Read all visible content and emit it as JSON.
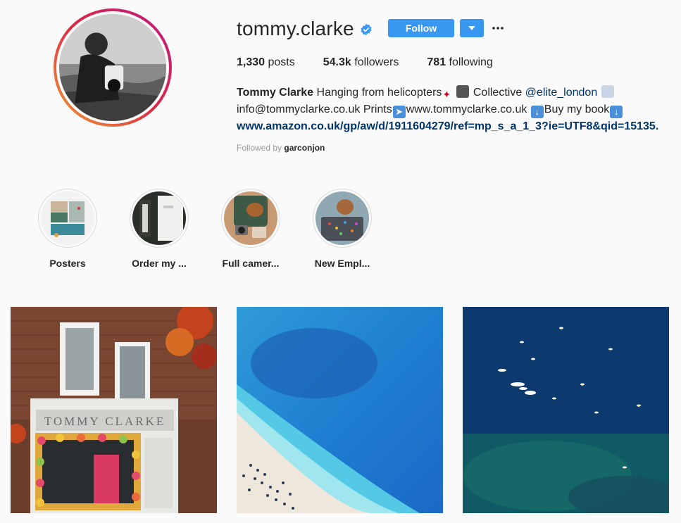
{
  "profile": {
    "username": "tommy.clarke",
    "verified": true,
    "full_name": "Tommy Clarke",
    "bio_line1_text": "Hanging from helicopters",
    "bio_line1_after": "Collective",
    "bio_mention": "@elite_london",
    "bio_line2_a": "info@tommyclarke.co.uk Prints",
    "bio_line2_b": "www.tommyclarke.co.uk",
    "bio_line2_c": "Buy my book",
    "bio_link": "www.amazon.co.uk/gp/aw/d/1911604279/ref=mp_s_a_1_3?ie=UTF8&qid=15135...",
    "followed_by_label": "Followed by",
    "followed_by_user": "garconjon"
  },
  "actions": {
    "follow_label": "Follow"
  },
  "stats": {
    "posts_count": "1,330",
    "posts_label": "posts",
    "followers_count": "54.3k",
    "followers_label": "followers",
    "following_count": "781",
    "following_label": "following"
  },
  "highlights": [
    {
      "label": "Posters"
    },
    {
      "label": "Order my ..."
    },
    {
      "label": "Full camer..."
    },
    {
      "label": "New Empl..."
    }
  ],
  "colors": {
    "accent": "#3897f0",
    "link": "#003569",
    "ring_start": "#f09433",
    "ring_end": "#bc1888"
  },
  "icons": [
    "verified-badge-icon",
    "chevron-down-icon",
    "more-options-icon"
  ]
}
